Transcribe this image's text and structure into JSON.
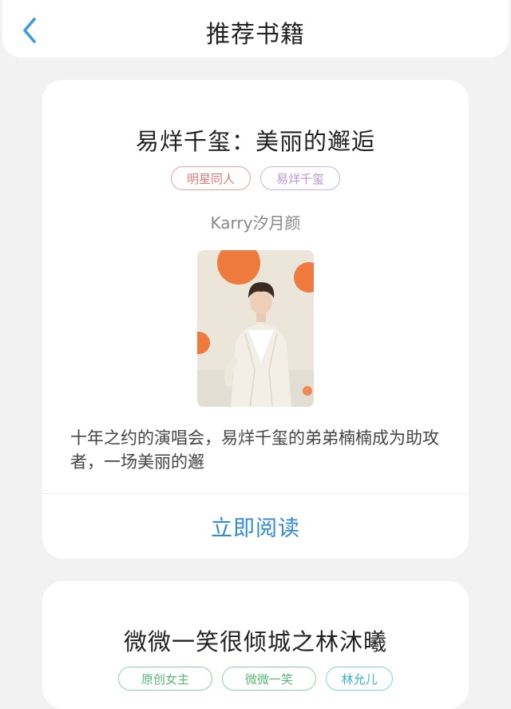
{
  "header": {
    "title": "推荐书籍"
  },
  "colors": {
    "accent": "#2f8ad8",
    "background": "#f2f2f2"
  },
  "books": [
    {
      "title": "易烊千玺：美丽的邂逅",
      "tags": [
        "明星同人",
        "易烊千玺"
      ],
      "author": "Karry汐月颜",
      "description": "十年之约的演唱会，易烊千玺的弟弟楠楠成为助攻者，一场美丽的邂",
      "read_label": "立即阅读"
    },
    {
      "title": "微微一笑很倾城之林沐曦",
      "tags": [
        "原创女主",
        "微微一笑",
        "林允儿"
      ]
    }
  ]
}
